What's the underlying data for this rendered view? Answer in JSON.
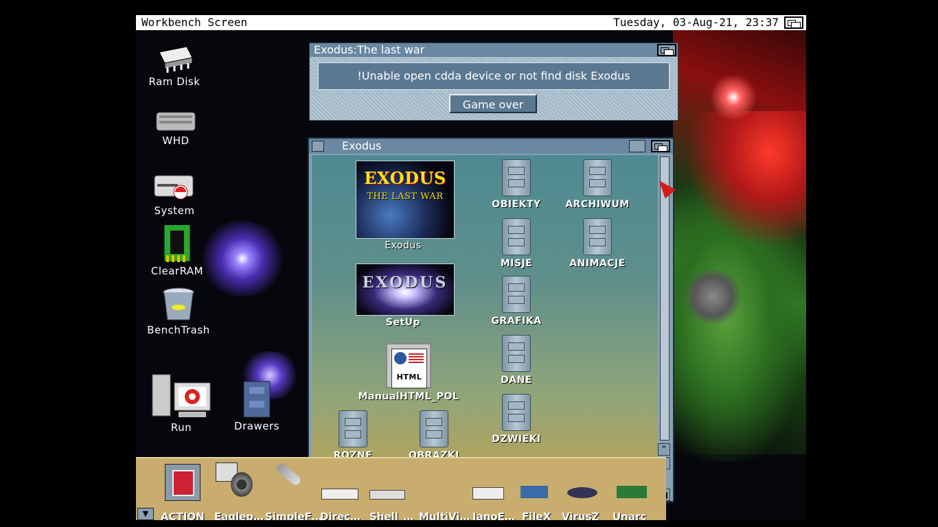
{
  "screen": {
    "title": "Workbench Screen",
    "datetime": "Tuesday, 03-Aug-21, 23:37"
  },
  "desktop_icons": [
    {
      "label": "Ram Disk",
      "icon": "ram-chip-icon"
    },
    {
      "label": "WHD",
      "icon": "hard-disk-icon"
    },
    {
      "label": "System",
      "icon": "system-drive-icon"
    },
    {
      "label": "ClearRAM",
      "icon": "memory-module-icon"
    },
    {
      "label": "BenchTrash",
      "icon": "trash-can-icon"
    },
    {
      "label": "Run",
      "icon": "computer-icon"
    },
    {
      "label": "Drawers",
      "icon": "drawer-cabinet-icon"
    }
  ],
  "requester": {
    "title": "Exodus:The last war",
    "message": "!Unable open cdda device or not find disk Exodus",
    "button": "Game over"
  },
  "window": {
    "title": "Exodus",
    "icons": [
      {
        "label": "Exodus",
        "type": "image"
      },
      {
        "label": "SetUp",
        "type": "image"
      },
      {
        "label": "ManualHTML_POL",
        "type": "document"
      },
      {
        "label": "OBIEKTY",
        "type": "drawer"
      },
      {
        "label": "ARCHIWUM",
        "type": "drawer"
      },
      {
        "label": "MISJE",
        "type": "drawer"
      },
      {
        "label": "ANIMACJE",
        "type": "drawer"
      },
      {
        "label": "GRAFIKA",
        "type": "drawer"
      },
      {
        "label": "DANE",
        "type": "drawer"
      },
      {
        "label": "DZWIEKI",
        "type": "drawer"
      },
      {
        "label": "ROZNE",
        "type": "drawer"
      },
      {
        "label": "OBRAZKI",
        "type": "drawer"
      }
    ],
    "exodus_art": {
      "line1": "EXODUS",
      "line2": "THE LAST WAR"
    },
    "setup_art": "EXODUS",
    "manual_art": "HTML"
  },
  "dock": {
    "items": [
      "ACTION",
      "Eaglep…",
      "SimpleF…",
      "Direc…",
      "Shell_…",
      "MultiVi…",
      "JanoE…",
      "FileX",
      "VirusZ",
      "Unarc"
    ]
  },
  "colors": {
    "titlebar": "#ffffff",
    "window_title": "#6a88a2",
    "dock": "#c8ad6e",
    "pointer": "#d31b1b"
  }
}
